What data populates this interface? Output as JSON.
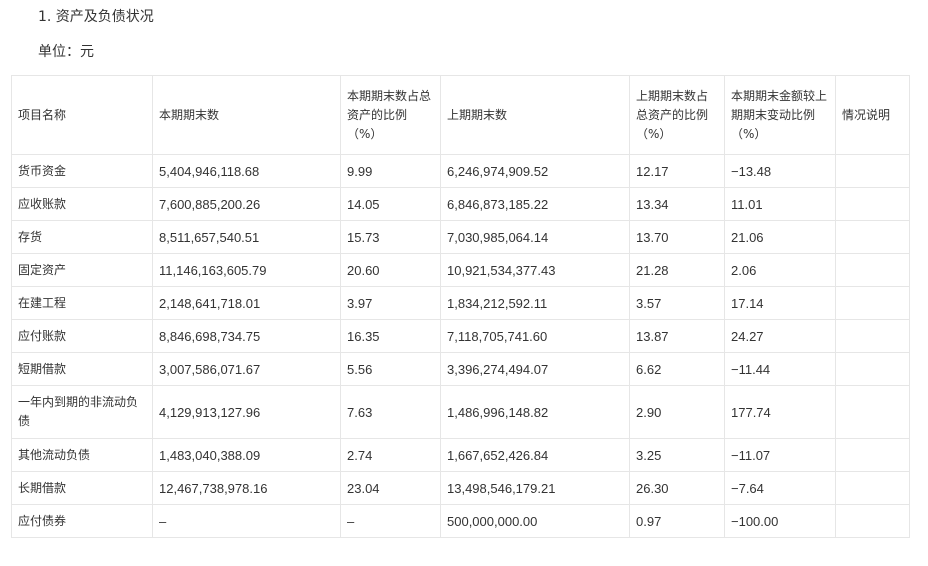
{
  "section_title": "1. 资产及负债状况",
  "unit_label": "单位：元",
  "table": {
    "headers": [
      "项目名称",
      "本期期末数",
      "本期期末数占总资产的比例（%）",
      "上期期末数",
      "上期期末数占总资产的比例（%）",
      "本期期末金额较上期期末变动比例（%）",
      "情况说明"
    ],
    "rows": [
      [
        "货币资金",
        "5,404,946,118.68",
        "9.99",
        "6,246,974,909.52",
        "12.17",
        "−13.48",
        ""
      ],
      [
        "应收账款",
        "7,600,885,200.26",
        "14.05",
        "6,846,873,185.22",
        "13.34",
        "11.01",
        ""
      ],
      [
        "存货",
        "8,511,657,540.51",
        "15.73",
        "7,030,985,064.14",
        "13.70",
        "21.06",
        ""
      ],
      [
        "固定资产",
        "11,146,163,605.79",
        "20.60",
        "10,921,534,377.43",
        "21.28",
        "2.06",
        ""
      ],
      [
        "在建工程",
        "2,148,641,718.01",
        "3.97",
        "1,834,212,592.11",
        "3.57",
        "17.14",
        ""
      ],
      [
        "应付账款",
        "8,846,698,734.75",
        "16.35",
        "7,118,705,741.60",
        "13.87",
        "24.27",
        ""
      ],
      [
        "短期借款",
        "3,007,586,071.67",
        "5.56",
        "3,396,274,494.07",
        "6.62",
        "−11.44",
        ""
      ],
      [
        "一年内到期的非流动负债",
        "4,129,913,127.96",
        "7.63",
        "1,486,996,148.82",
        "2.90",
        "177.74",
        ""
      ],
      [
        "其他流动负债",
        "1,483,040,388.09",
        "2.74",
        "1,667,652,426.84",
        "3.25",
        "−11.07",
        ""
      ],
      [
        "长期借款",
        "12,467,738,978.16",
        "23.04",
        "13,498,546,179.21",
        "26.30",
        "−7.64",
        ""
      ],
      [
        "应付债券",
        "–",
        "–",
        "500,000,000.00",
        "0.97",
        "−100.00",
        ""
      ]
    ]
  }
}
